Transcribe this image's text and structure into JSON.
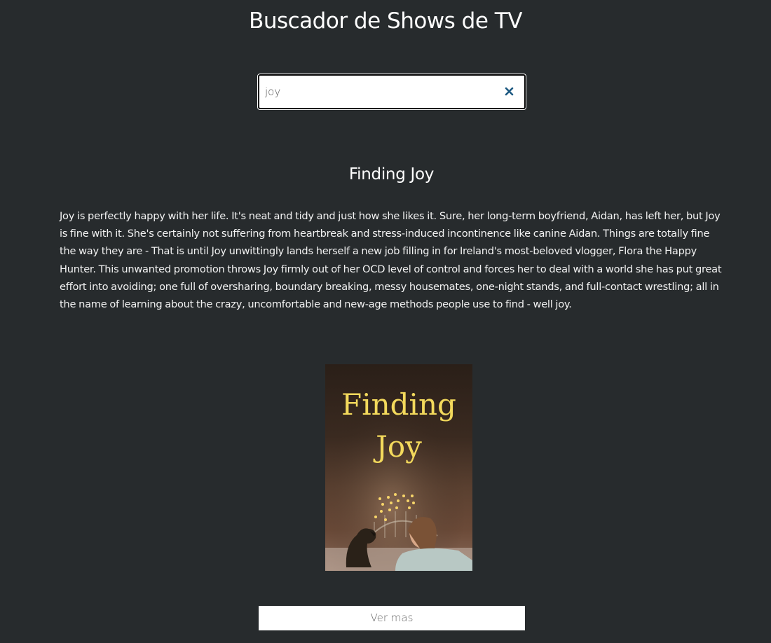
{
  "header": {
    "title": "Buscador de Shows de TV"
  },
  "search": {
    "value": "joy",
    "clear_icon": "close-icon",
    "clear_color": "#1e5a82"
  },
  "show": {
    "title": "Finding Joy",
    "summary": "Joy is perfectly happy with her life. It's neat and tidy and just how she likes it. Sure, her long-term boyfriend, Aidan, has left her, but Joy is fine with it. She's certainly not suffering from heartbreak and stress-induced incontinence like canine Aidan. Things are totally fine the way they are - That is until Joy unwittingly lands herself a new job filling in for Ireland's most-beloved vlogger, Flora the Happy Hunter. This unwanted promotion throws Joy firmly out of her OCD level of control and forces her to deal with a world she has put great effort into avoiding; one full of oversharing, boundary breaking, messy housemates, one-night stands, and full-contact wrestling; all in the name of learning about the crazy, uncomfortable and new-age methods people use to find - well joy.",
    "poster": {
      "title_line1": "Finding",
      "title_line2": "Joy",
      "title_color": "#f3d95c"
    }
  },
  "actions": {
    "view_more_label": "Ver mas"
  },
  "colors": {
    "background": "#272b2d",
    "text": "#ffffff"
  }
}
